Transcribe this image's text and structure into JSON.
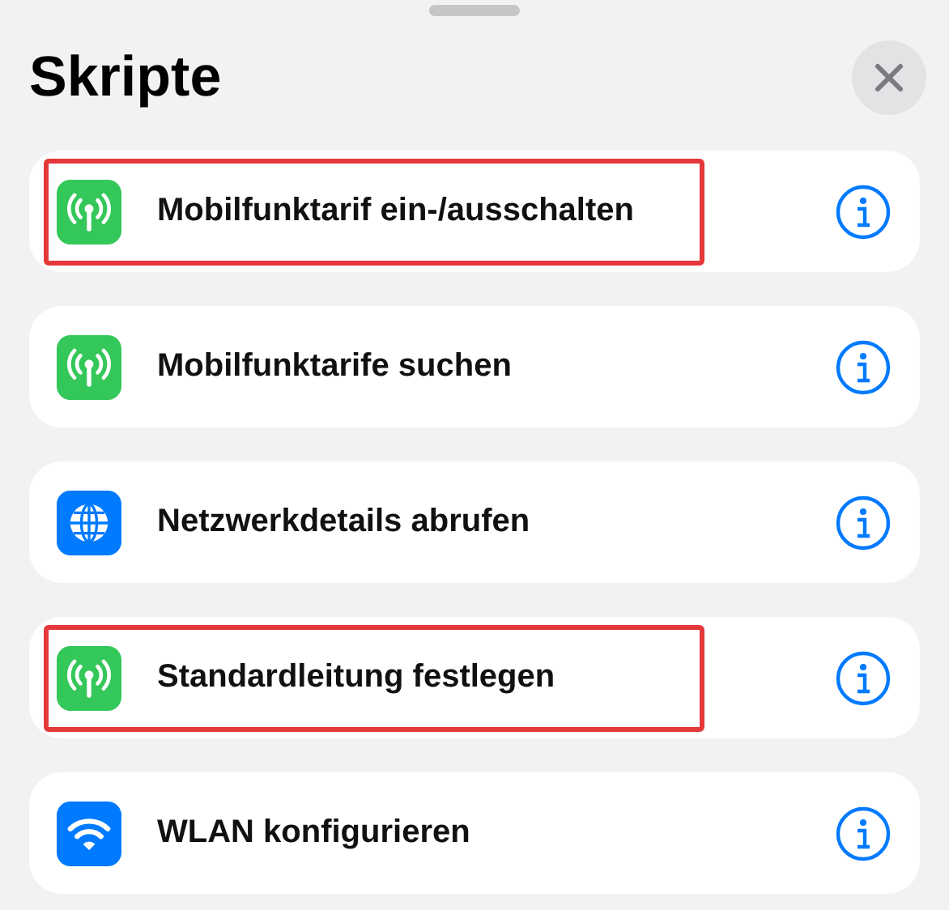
{
  "sheet": {
    "title": "Skripte"
  },
  "items": [
    {
      "label": "Mobilfunktarif ein-/ausschalten",
      "kind": "antenna",
      "highlighted": true
    },
    {
      "label": "Mobilfunktarife suchen",
      "kind": "antenna",
      "highlighted": false
    },
    {
      "label": "Netzwerkdetails abrufen",
      "kind": "globe",
      "highlighted": false
    },
    {
      "label": "Standardleitung festlegen",
      "kind": "antenna",
      "highlighted": true
    },
    {
      "label": "WLAN konfigurieren",
      "kind": "wifi",
      "highlighted": false
    }
  ]
}
